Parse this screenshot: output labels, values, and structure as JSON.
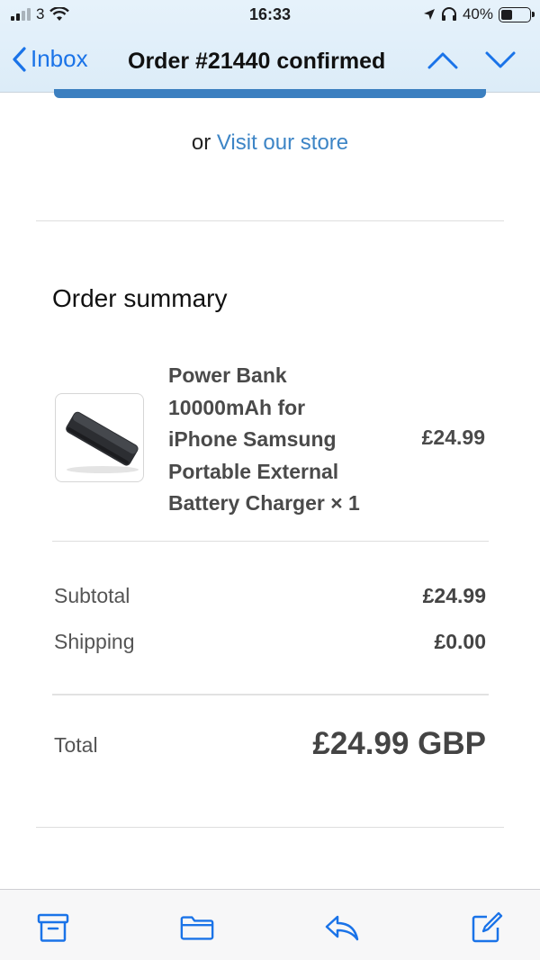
{
  "status_bar": {
    "carrier": "3",
    "time": "16:33",
    "battery": "40%",
    "battery_level": 0.4
  },
  "nav": {
    "back_label": "Inbox",
    "title": "Order #21440 confirmed"
  },
  "email": {
    "visit_prefix": "or",
    "visit_link": "Visit our store",
    "summary_title": "Order summary",
    "item": {
      "name_lines": [
        "Power Bank",
        "10000mAh for",
        "iPhone Samsung",
        "Portable External",
        "Battery Charger × 1"
      ],
      "price": "£24.99"
    },
    "subtotal_label": "Subtotal",
    "subtotal_value": "£24.99",
    "shipping_label": "Shipping",
    "shipping_value": "£0.00",
    "total_label": "Total",
    "total_value": "£24.99 GBP"
  },
  "colors": {
    "link": "#3d85c6",
    "nav_accent": "#1a73e8"
  }
}
